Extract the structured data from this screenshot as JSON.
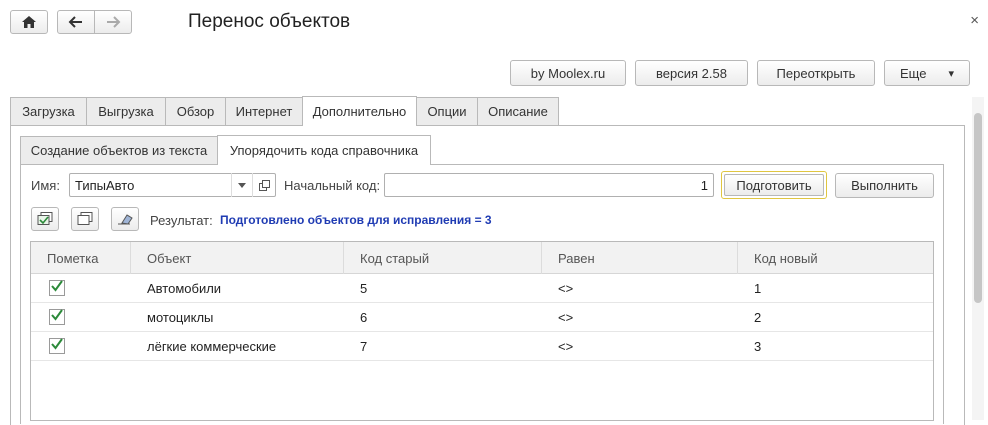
{
  "window": {
    "title": "Перенос объектов",
    "close_glyph": "×"
  },
  "header_buttons": {
    "moolex": "by Moolex.ru",
    "version": "версия 2.58",
    "reopen": "Переоткрыть",
    "more": "Еще",
    "more_arrow": "▾"
  },
  "tabs": [
    {
      "label": "Загрузка"
    },
    {
      "label": "Выгрузка"
    },
    {
      "label": "Обзор"
    },
    {
      "label": "Интернет"
    },
    {
      "label": "Дополнительно"
    },
    {
      "label": "Опции"
    },
    {
      "label": "Описание"
    }
  ],
  "active_tab": "Дополнительно",
  "subtabs": [
    {
      "label": "Создание объектов из текста"
    },
    {
      "label": "Упорядочить кода справочника"
    }
  ],
  "active_subtab": "Упорядочить кода справочника",
  "form": {
    "name_label": "Имя:",
    "name_value": "ТипыАвто",
    "start_code_label": "Начальный код:",
    "start_code_value": "1",
    "prepare_button": "Подготовить",
    "execute_button": "Выполнить",
    "result_label": "Результат:",
    "result_value": "Подготовлено объектов для исправления = 3"
  },
  "table": {
    "columns": [
      "Пометка",
      "Объект",
      "Код старый",
      "Равен",
      "Код новый"
    ],
    "rows": [
      {
        "checked": true,
        "object": "Автомобили",
        "old": "5",
        "eq": "<>",
        "new": "1"
      },
      {
        "checked": true,
        "object": "мотоциклы",
        "old": "6",
        "eq": "<>",
        "new": "2"
      },
      {
        "checked": true,
        "object": "лёгкие коммерческие",
        "old": "7",
        "eq": "<>",
        "new": "3"
      }
    ]
  },
  "colors": {
    "result_text": "#1f3bb3",
    "checkmark": "#2c8a3a",
    "prepare_border": "#e0c640"
  }
}
